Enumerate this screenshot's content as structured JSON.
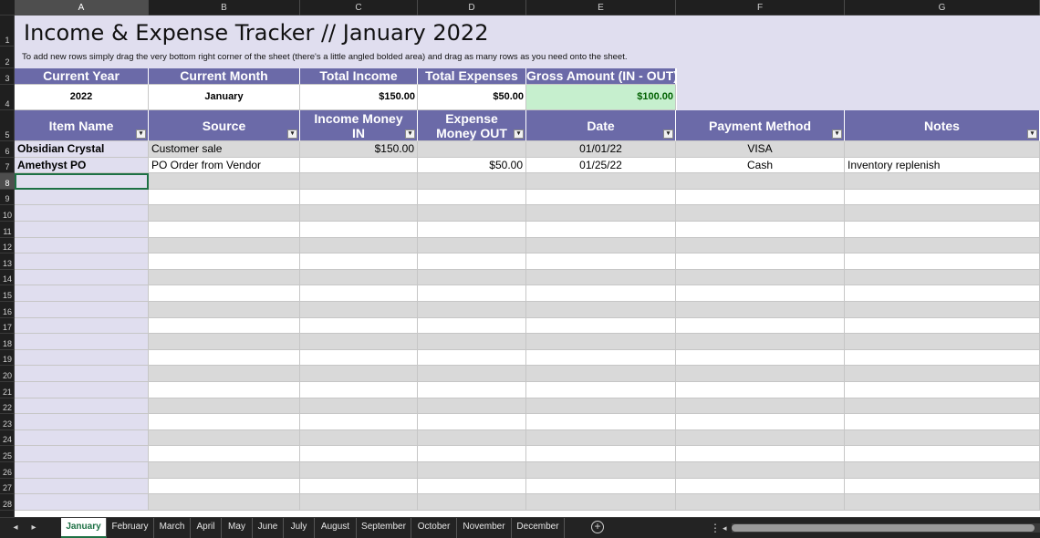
{
  "columns": [
    "A",
    "B",
    "C",
    "D",
    "E",
    "F",
    "G"
  ],
  "rows": [
    "1",
    "2",
    "3",
    "4",
    "5",
    "6",
    "7",
    "8",
    "9",
    "10",
    "11",
    "12",
    "13",
    "14",
    "15",
    "16",
    "17",
    "18",
    "19",
    "20",
    "21",
    "22",
    "23",
    "24",
    "25",
    "26",
    "27",
    "28"
  ],
  "sheet": {
    "title": "Income & Expense Tracker // January 2022",
    "subtitle": "To add new rows simply drag the very bottom right corner of the sheet (there's a little angled bolded area) and drag as many rows as you need onto the sheet."
  },
  "summary": {
    "headers": [
      "Current Year",
      "Current Month",
      "Total Income",
      "Total Expenses",
      "Gross Amount (IN - OUT)"
    ],
    "values": [
      "2022",
      "January",
      "$150.00",
      "$50.00",
      "$100.00"
    ]
  },
  "table": {
    "headers": [
      "Item Name",
      "Source",
      "Income Money IN",
      "Expense Money OUT",
      "Date",
      "Payment Method",
      "Notes"
    ],
    "rows": [
      [
        "Obsidian Crystal",
        "Customer sale",
        "$150.00",
        "",
        "01/01/22",
        "VISA",
        ""
      ],
      [
        "Amethyst PO",
        "PO Order from Vendor",
        "",
        "$50.00",
        "01/25/22",
        "Cash",
        "Inventory replenish"
      ]
    ]
  },
  "tabs": [
    "January",
    "February",
    "March",
    "April",
    "May",
    "June",
    "July",
    "August",
    "September",
    "October",
    "November",
    "December"
  ],
  "active_tab": "January",
  "icons": {
    "filter": "filter-dropdown-icon",
    "add_sheet": "plus-circle-icon",
    "more": "vertical-ellipsis-icon"
  },
  "colors": {
    "header_purple": "#6b6aa8",
    "band_lavender": "#e0deef",
    "stripe_gray": "#d9d9d9",
    "gross_green": "#c6efce",
    "active_green": "#1d7044"
  }
}
